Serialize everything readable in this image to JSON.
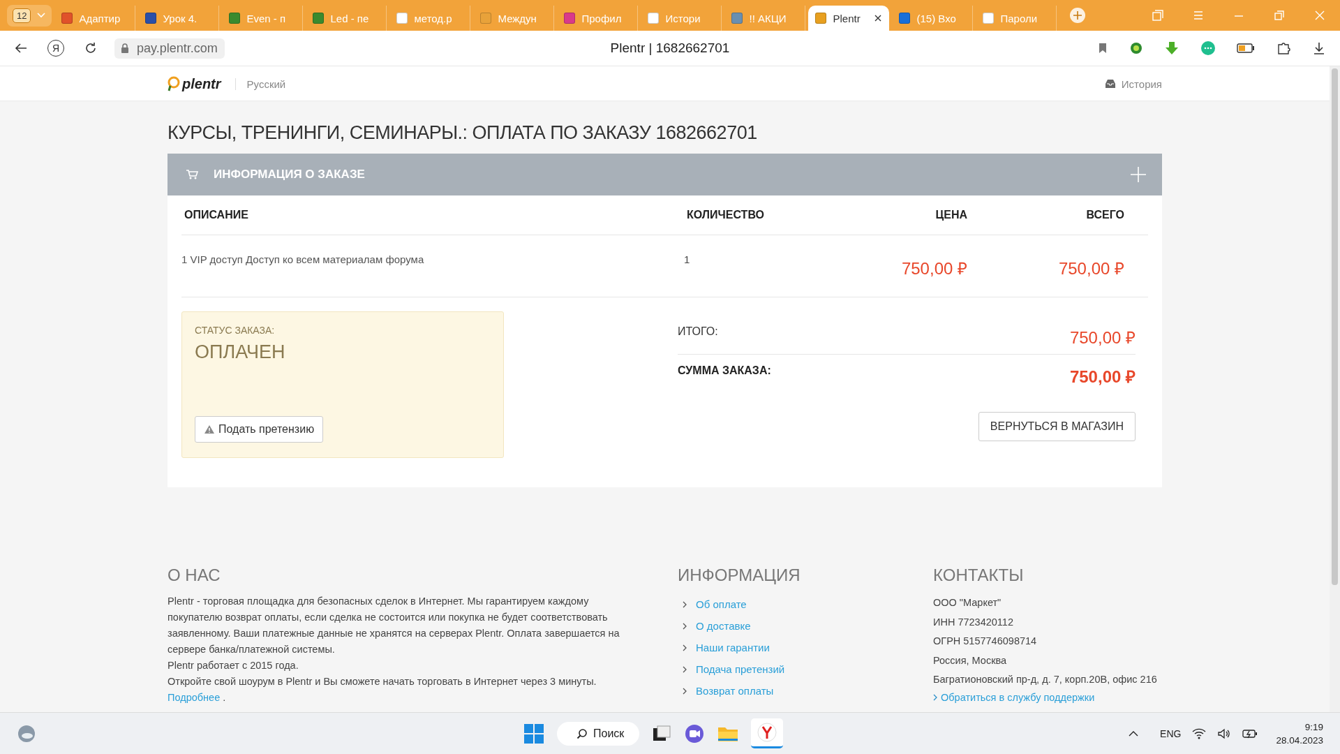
{
  "browser": {
    "tab_count": "12",
    "tabs": [
      {
        "title": "Адаптир",
        "selected": false,
        "color": "#e0522a"
      },
      {
        "title": "Урок 4.",
        "selected": false,
        "color": "#2b4fa8"
      },
      {
        "title": "Even - п",
        "selected": false,
        "color": "#3a8a2e"
      },
      {
        "title": "Led - пе",
        "selected": false,
        "color": "#3a8a2e"
      },
      {
        "title": "метод.р",
        "selected": false,
        "color": "#ffffff"
      },
      {
        "title": "Междун",
        "selected": false,
        "color": "#e8a23a"
      },
      {
        "title": "Профил",
        "selected": false,
        "color": "#d93a8a"
      },
      {
        "title": "Истори",
        "selected": false,
        "color": "#ffffff"
      },
      {
        "title": "!! АКЦИ",
        "selected": false,
        "color": "#6a8fb0"
      },
      {
        "title": "Plentr",
        "selected": true,
        "color": "#e8a020"
      },
      {
        "title": "(15) Вхо",
        "selected": false,
        "color": "#1a6fd8"
      },
      {
        "title": "Пароли",
        "selected": false,
        "color": "#ffffff"
      }
    ],
    "yandex_button": "Я",
    "url": "pay.plentr.com",
    "page_title": "Plentr | 1682662701"
  },
  "site_header": {
    "logo": "plentr",
    "language": "Русский",
    "history_link": "История"
  },
  "page_title": "КУРСЫ, ТРЕНИНГИ, СЕМИНАРЫ.: ОПЛАТА ПО ЗАКАЗУ 1682662701",
  "order_panel": {
    "title": "ИНФОРМАЦИЯ О ЗАКАЗЕ",
    "columns": [
      "ОПИСАНИЕ",
      "КОЛИЧЕСТВО",
      "ЦЕНА",
      "ВСЕГО"
    ],
    "rows": [
      {
        "description": "1 VIP доступ Доступ ко всем материалам форума",
        "quantity": "1",
        "price": "750,00 ₽",
        "total": "750,00 ₽"
      }
    ],
    "status": {
      "label": "СТАТУС ЗАКАЗА:",
      "value": "ОПЛАЧЕН",
      "claim_button": "Подать претензию"
    },
    "totals": [
      {
        "kind": "subtotal",
        "label": "ИТОГО:",
        "value": "750,00 ₽"
      },
      {
        "kind": "grand",
        "label": "СУММА ЗАКАЗА:",
        "value": "750,00 ₽"
      }
    ],
    "back_button": "ВЕРНУТЬСЯ В МАГАЗИН"
  },
  "footer": {
    "about": {
      "heading": "О НАС",
      "paragraphs": [
        "Plentr - торговая площадка для безопасных сделок в Интернет. Мы гарантируем каждому покупателю возврат оплаты, если сделка не состоится или покупка не будет соответствовать заявленному. Ваши платежные данные не хранятся на серверах Plentr. Оплата завершается на сервере банка/платежной системы.",
        "Plentr работает с 2015 года.",
        "Откройте свой шоурум в Plentr и Вы сможете начать торговать в Интернет через 3 минуты."
      ],
      "more_link": "Подробнее",
      "more_tail": "."
    },
    "info": {
      "heading": "ИНФОРМАЦИЯ",
      "links": [
        "Об оплате",
        "О доставке",
        "Наши гарантии",
        "Подача претензий",
        "Возврат оплаты"
      ]
    },
    "contacts": {
      "heading": "КОНТАКТЫ",
      "lines": [
        "ООО \"Маркет\"",
        "ИНН 7723420112",
        "ОГРН 5157746098714",
        "Россия, Москва",
        "Багратионовский пр-д, д. 7, корп.20В, офис 216"
      ],
      "support_link": "Обратиться в службу поддержки"
    }
  },
  "taskbar": {
    "search": "Поиск",
    "language": "ENG",
    "time": "9:19",
    "date": "28.04.2023"
  }
}
